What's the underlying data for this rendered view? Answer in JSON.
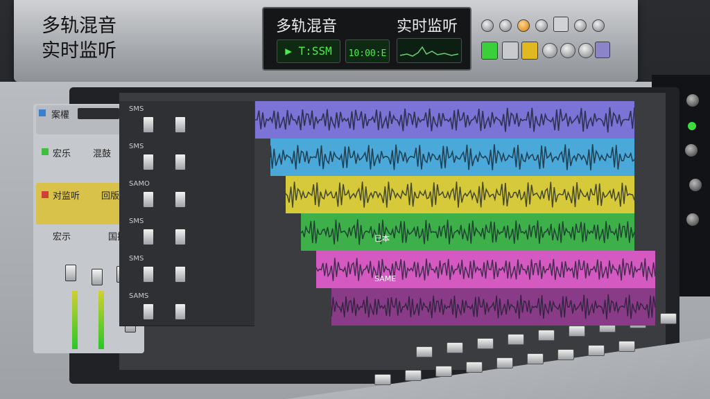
{
  "console": {
    "title": "多轨混音\n实时监听"
  },
  "display": {
    "title": "多轨混音",
    "monitor": "实时监听",
    "time_readout": "T:SSM",
    "counter_readout": "10:00:E"
  },
  "left_panel": {
    "rows": [
      {
        "label": "案權"
      },
      {
        "label": "宏乐"
      },
      {
        "label": "对监听"
      },
      {
        "label": "宏示"
      }
    ],
    "side_labels": [
      "混鼓",
      "回版",
      "国插"
    ]
  },
  "tracks": [
    {
      "name": "SMS",
      "color": "#7b73d6"
    },
    {
      "name": "SMS",
      "color": "#4aa9d8"
    },
    {
      "name": "SAMO",
      "color": "#d6c93a"
    },
    {
      "name": "SMS",
      "color": "#3db04a"
    },
    {
      "name": "SMS",
      "color": "#d45ac2"
    },
    {
      "name": "SAMS",
      "color": "#8a3b88"
    }
  ],
  "clip_labels": [
    "巳本",
    "SAME"
  ],
  "colors": {
    "accent_green": "#4af04a",
    "panel_gray": "#b9bcc0"
  },
  "icons": [
    "knob-icon",
    "led-icon",
    "fader-icon",
    "waveform-icon"
  ]
}
